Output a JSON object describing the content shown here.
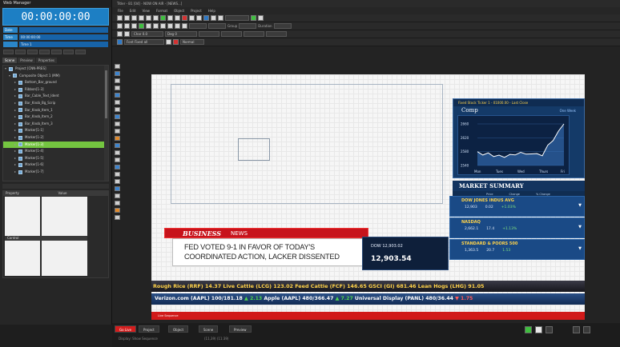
{
  "left_panel": {
    "title": "Web Manager",
    "clock": "00:00:00:00",
    "fields": [
      {
        "label": "Date",
        "value": ""
      },
      {
        "label": "Time",
        "value": "00:00:00:00"
      },
      {
        "label": "",
        "value": "Time 1"
      }
    ],
    "tabs": [
      "Scene",
      "Preview",
      "Properties"
    ],
    "tree_items": [
      "Project [CNN-PRES]",
      "Composite Object 1 (MM)",
      "Bottom_Bar_ground",
      "Ribbon[1-3]",
      "Bar_Cable_Text_Ident",
      "Bar_Knob_Bg_Scrip",
      "Bar_Knob_Item_1",
      "Bar_Knob_Item_2",
      "Bar_Knob_Item_3",
      "Marker[1-1]",
      "Marker[1-2]",
      "Marker[1-3]",
      "Marker[1-4]",
      "Marker[1-5]",
      "Marker[1-6]",
      "Marker[1-7]"
    ],
    "selected_index": 11,
    "props_header": [
      "Property",
      "Value"
    ],
    "props_band": "Control",
    "props_title": "Marker 1"
  },
  "main": {
    "title": "Titler - B1 [04] - NOW ON AIR - [NEWS...]",
    "menus": [
      "File",
      "Edit",
      "View",
      "Format",
      "Object",
      "Project",
      "Help"
    ],
    "toolbar_labels": {
      "x": "X",
      "y": "Y",
      "w": "W",
      "h": "H",
      "duration": "Duration",
      "group": "Group",
      "font": "Font",
      "field_row2_a": "Char 0.0",
      "field_row2_b": "Deg 0",
      "field_row3_a": "Font Fixed all",
      "field_row3_b": "Normal"
    },
    "stock": {
      "header": "Fixed Stock Ticker 1 - 01000.00 - Last Close",
      "name": "Comp",
      "range": "One Week",
      "chart_data": {
        "type": "area",
        "categories": [
          "Mon",
          "Tues",
          "Wed",
          "Thurs",
          "Fri"
        ],
        "values": [
          2580,
          2565,
          2575,
          2570,
          2660
        ],
        "ylabels": [
          "2660",
          "2620",
          "2580",
          "2540"
        ]
      }
    },
    "market_summary": {
      "title": "MARKET SUMMARY",
      "cols": [
        "Price",
        "Change",
        "% Change"
      ],
      "rows": [
        {
          "name": "DOW JONES INDUS AVG",
          "price": "12,903",
          "change": "0.02",
          "pct": "+1.03%"
        },
        {
          "name": "NASDAQ",
          "price": "2,662.1",
          "change": "17.4",
          "pct": "+1.13%"
        },
        {
          "name": "STANDARD & POORS 500",
          "price": "1,363.5",
          "change": "20.7",
          "pct": "1.53"
        }
      ]
    },
    "lower_third": {
      "brand_a": "BUSINESS",
      "brand_b": "NEWS",
      "line1": "FED VOTED 9-1 IN FAVOR OF TODAY'S",
      "line2": "COORDINATED ACTION, LACKER DISSENTED",
      "side_line": "DOW 12,903.02",
      "side_value": "12,903.54"
    },
    "ticker1": "Rough Rice (RRF) 14.37    Live Cattle (LCG) 123.02    Feed Cattle (FCF) 146.65    GSCI (GI) 681.46    Lean Hogs (LHG) 91.05",
    "ticker2": [
      {
        "t": "Verizon.com (AAPL) 100/181.18 ",
        "c": ""
      },
      {
        "t": "▲ 2.13",
        "c": "up"
      },
      {
        "t": "   Apple (AAPL) 480/366.47 ",
        "c": ""
      },
      {
        "t": "▲ 7.27",
        "c": "up"
      },
      {
        "t": "   Universal Display (PANL) 480/36.44 ",
        "c": ""
      },
      {
        "t": "▼ 1.75",
        "c": "dn"
      }
    ],
    "redbar": "Live Sequence",
    "bottom": {
      "tabs": [
        "Go Live",
        "Project",
        "Object",
        "Scene",
        "Preview"
      ],
      "status": "Display: Show Sequence",
      "coords": "(11,39) (11:39)"
    }
  }
}
